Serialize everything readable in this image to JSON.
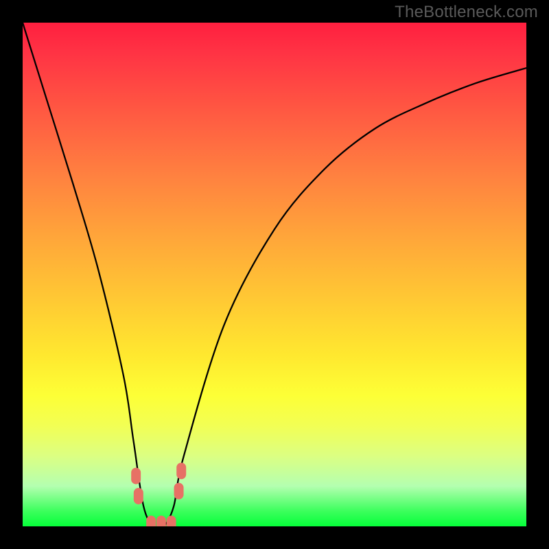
{
  "watermark": "TheBottleneck.com",
  "chart_data": {
    "type": "line",
    "title": "",
    "xlabel": "",
    "ylabel": "",
    "ylim": [
      0,
      100
    ],
    "xlim": [
      0,
      100
    ],
    "series": [
      {
        "name": "bottleneck-curve",
        "x": [
          0,
          5,
          10,
          15,
          20,
          22,
          24,
          26,
          28,
          30,
          32,
          40,
          50,
          60,
          70,
          80,
          90,
          100
        ],
        "values": [
          100,
          84,
          68,
          51,
          30,
          17,
          4,
          0,
          0,
          4,
          14,
          40,
          59,
          71,
          79,
          84,
          88,
          91
        ]
      }
    ],
    "markers": [
      {
        "name": "left-cluster-top",
        "x": 22.5,
        "y": 10
      },
      {
        "name": "left-cluster-bottom",
        "x": 23.0,
        "y": 6
      },
      {
        "name": "right-cluster-top",
        "x": 31.5,
        "y": 11
      },
      {
        "name": "right-cluster-bottom",
        "x": 31.0,
        "y": 7
      },
      {
        "name": "floor-left",
        "x": 25.5,
        "y": 0.5
      },
      {
        "name": "floor-mid",
        "x": 27.5,
        "y": 0.5
      },
      {
        "name": "floor-right",
        "x": 29.5,
        "y": 0.5
      }
    ],
    "marker_color": "#e77165"
  }
}
